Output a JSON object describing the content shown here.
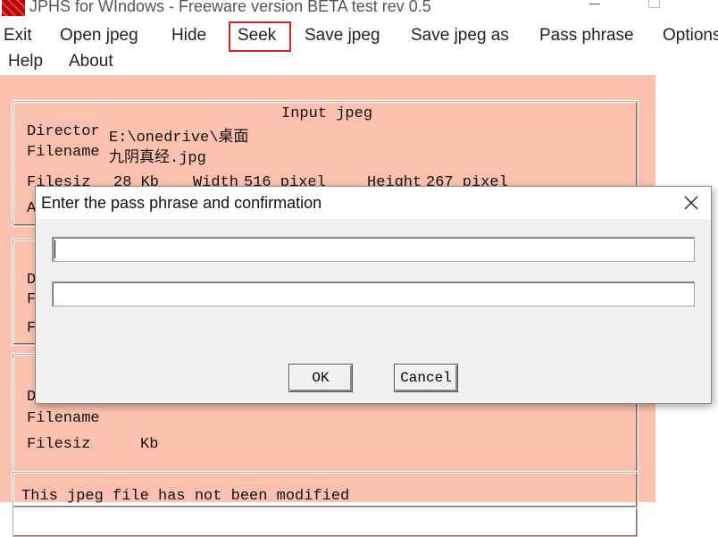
{
  "window": {
    "title": "JPHS for WIndows - Freeware version BETA test rev 0.5",
    "icon": "app-icon"
  },
  "menu": {
    "items": [
      "Exit",
      "Open jpeg",
      "Hide",
      "Seek",
      "Save jpeg",
      "Save jpeg as",
      "Pass phrase",
      "Options",
      "Help",
      "About"
    ],
    "highlighted": "Seek",
    "highlight_color": "#d22020"
  },
  "input_jpeg": {
    "heading": "Input jpeg",
    "directory_label": "Director",
    "directory_value": "E:\\onedrive\\桌面",
    "filename_label": "Filename",
    "filename_value": "九阴真经.jpg",
    "filesize_label": "Filesiz",
    "filesize_value": "28 Kb",
    "width_label": "Width",
    "width_value": "516 pixel",
    "height_label": "Height",
    "height_value": "267 pixel",
    "row4_label": "A"
  },
  "group2": {
    "dir_label": "D",
    "file_label": "F",
    "size_label": "F"
  },
  "output": {
    "dir_label": "D",
    "filename_label": "Filename",
    "filesize_label": "Filesiz",
    "filesize_unit": "Kb"
  },
  "status": {
    "message": "This jpeg file has not been modified"
  },
  "dialog": {
    "title": "Enter the pass phrase and confirmation",
    "passphrase_value": "",
    "confirmation_value": "",
    "ok_label": "OK",
    "cancel_label": "Cancel",
    "close_icon": "close-icon"
  },
  "colors": {
    "client_background": "#fcc0ae",
    "dialog_background": "#f0f0f0"
  }
}
